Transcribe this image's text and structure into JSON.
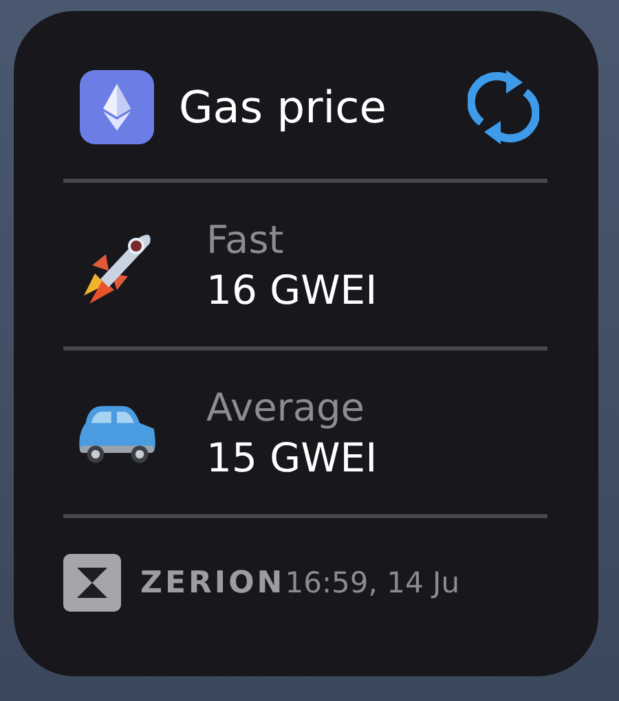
{
  "widget": {
    "title": "Gas price"
  },
  "rows": [
    {
      "kind": "rocket",
      "label": "Fast",
      "value": "16 GWEI"
    },
    {
      "kind": "car",
      "label": "Average",
      "value": "15 GWEI"
    }
  ],
  "footer": {
    "brand": "ZERION",
    "timestamp": "16:59, 14 Ju"
  }
}
